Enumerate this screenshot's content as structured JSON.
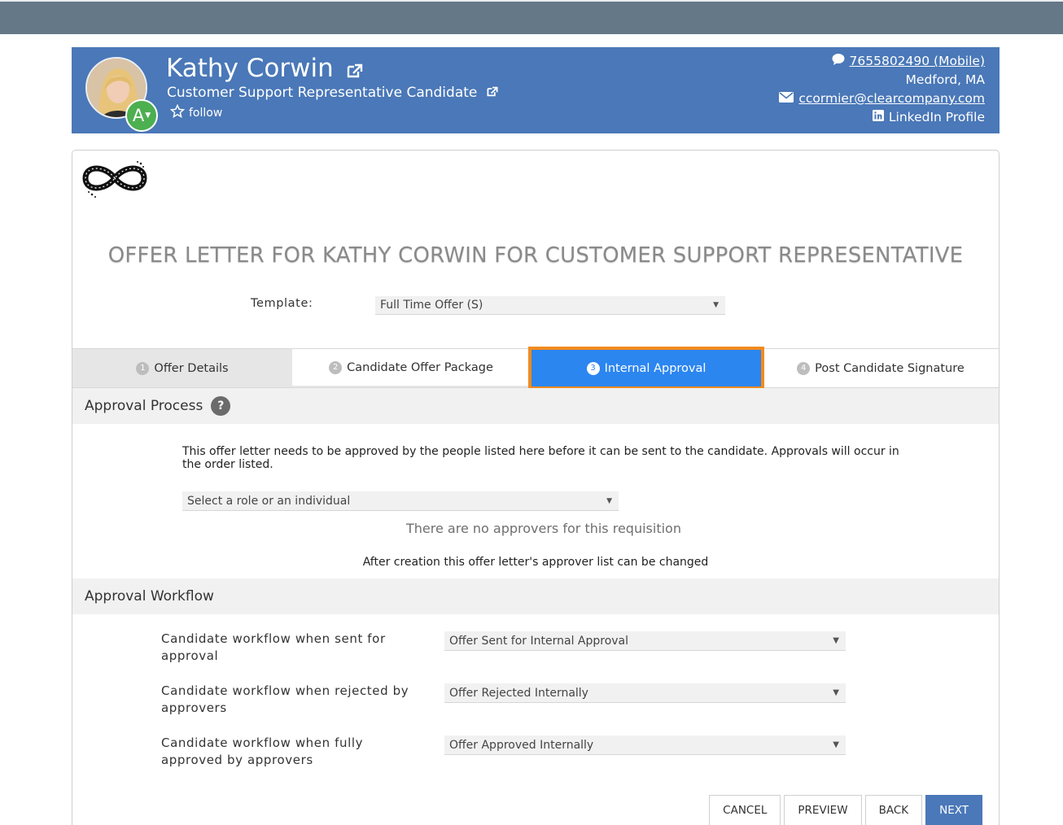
{
  "candidate": {
    "name": "Kathy Corwin",
    "title": "Customer Support Representative Candidate",
    "follow_label": "follow",
    "avatar_badge": "A",
    "phone": "7655802490 (Mobile)",
    "location": "Medford, MA",
    "email": "ccormier@clearcompany.com",
    "linkedin": "LinkedIn Profile"
  },
  "offer": {
    "heading": "OFFER LETTER FOR KATHY CORWIN FOR CUSTOMER SUPPORT REPRESENTATIVE",
    "template_label": "Template:",
    "template_value": "Full Time Offer (S)"
  },
  "tabs": [
    {
      "num": "1",
      "label": "Offer Details"
    },
    {
      "num": "2",
      "label": "Candidate Offer Package"
    },
    {
      "num": "3",
      "label": "Internal Approval"
    },
    {
      "num": "4",
      "label": "Post Candidate Signature"
    }
  ],
  "approval": {
    "title": "Approval Process",
    "help": "?",
    "description": "This offer letter needs to be approved by the people listed here before it can be sent to the candidate. Approvals will occur in the order listed.",
    "select_placeholder": "Select a role or an individual",
    "empty_text": "There are no approvers for this requisition",
    "note": "After creation this offer letter's approver list can be changed"
  },
  "workflow": {
    "title": "Approval Workflow",
    "rows": [
      {
        "label": "Candidate workflow when sent for approval",
        "value": "Offer Sent for Internal Approval"
      },
      {
        "label": "Candidate workflow when rejected by approvers",
        "value": "Offer Rejected Internally"
      },
      {
        "label": "Candidate workflow when fully approved by approvers",
        "value": "Offer Approved Internally"
      }
    ]
  },
  "buttons": {
    "cancel": "CANCEL",
    "preview": "PREVIEW",
    "back": "BACK",
    "next": "NEXT"
  },
  "colors": {
    "header": "#4a78b8",
    "active_tab": "#2c86f0",
    "highlight": "#f28b1f",
    "badge": "#4caf50"
  }
}
